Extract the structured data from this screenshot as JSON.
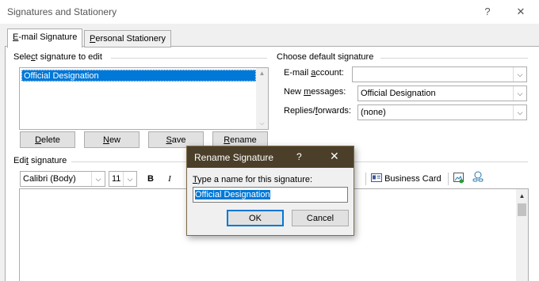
{
  "window": {
    "title": "Signatures and Stationery",
    "help_glyph": "?",
    "close_glyph": "✕"
  },
  "tabs": [
    {
      "label_pre": "",
      "label_u": "E",
      "label_post": "-mail Signature"
    },
    {
      "label_pre": "",
      "label_u": "P",
      "label_post": "ersonal Stationery"
    }
  ],
  "select_section": {
    "label_pre": "Sele",
    "label_u": "c",
    "label_post": "t signature to edit",
    "items": [
      "Official Designation"
    ]
  },
  "buttons": {
    "delete": {
      "u": "D",
      "rest": "elete"
    },
    "new": {
      "u": "N",
      "rest": "ew"
    },
    "save": {
      "u": "S",
      "rest": "ave"
    },
    "rename": {
      "u": "R",
      "rest": "ename"
    }
  },
  "default_section": {
    "title": "Choose default signature",
    "email_account": {
      "pre": "E-mail ",
      "u": "a",
      "post": "ccount:",
      "value": ""
    },
    "new_messages": {
      "pre": "New ",
      "u": "m",
      "post": "essages:",
      "value": "Official Designation"
    },
    "replies": {
      "pre": "Replies/",
      "u": "f",
      "post": "orwards:",
      "value": "(none)"
    }
  },
  "edit_section": {
    "label_pre": "Edi",
    "label_u": "t",
    "label_post": " signature",
    "font": "Calibri (Body)",
    "size": "11",
    "bold": "B",
    "italic": "I",
    "business_card": "Business Card"
  },
  "rename_dialog": {
    "title": "Rename Signature",
    "help_glyph": "?",
    "close_glyph": "✕",
    "prompt_u": "T",
    "prompt_rest": "ype a name for this signature:",
    "value": "Official Designation",
    "ok": "OK",
    "cancel": "Cancel"
  },
  "chevron": "⌵",
  "colors": {
    "selection": "#0078d7",
    "dialog_title": "#4b3f2a"
  }
}
